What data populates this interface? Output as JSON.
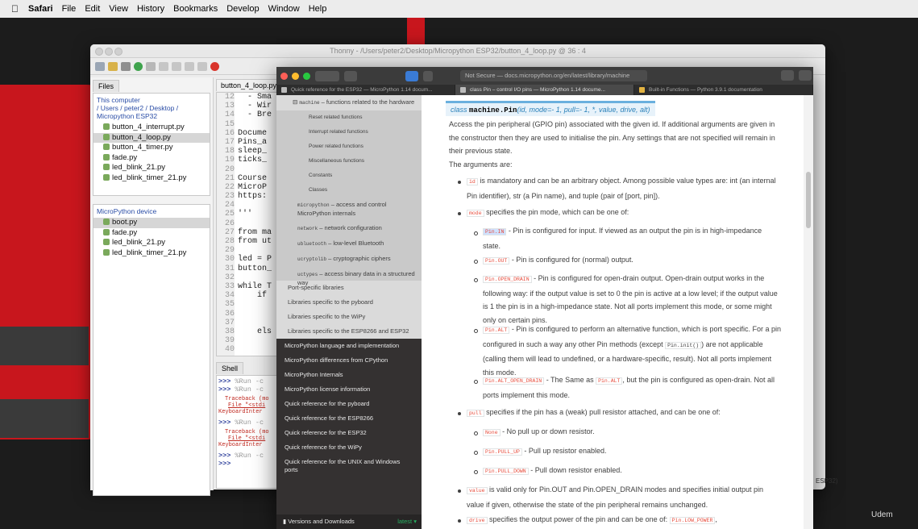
{
  "menubar": {
    "app": "Safari",
    "items": [
      "File",
      "Edit",
      "View",
      "History",
      "Bookmarks",
      "Develop",
      "Window",
      "Help"
    ]
  },
  "thonny": {
    "title": "Thonny - /Users/peter2/Desktop/Micropython ESP32/button_4_loop.py @ 36 : 4",
    "files_tab": "Files",
    "computer_path": "This computer\n/ Users / peter2 / Desktop /\nMicropython ESP32",
    "computer_files": [
      "button_4_interrupt.py",
      "button_4_loop.py",
      "button_4_timer.py",
      "fade.py",
      "led_blink_21.py",
      "led_blink_timer_21.py"
    ],
    "device_header": "MicroPython device",
    "device_files": [
      "boot.py",
      "fade.py",
      "led_blink_21.py",
      "led_blink_timer_21.py"
    ],
    "editor_tab": "button_4_loop.py",
    "line_numbers": [
      "12",
      "13",
      "14",
      "15",
      "16",
      "17",
      "18",
      "19",
      "20",
      "21",
      "22",
      "23",
      "24",
      "25",
      "26",
      "27",
      "28",
      "29",
      "30",
      "31",
      "32",
      "33",
      "34",
      "35",
      "36",
      "37",
      "38",
      "39",
      "40"
    ],
    "code_lines": [
      "  - Sma",
      "  - Wir",
      "  - Bre",
      "",
      "Docume",
      "Pins_a",
      "sleep_",
      "ticks_",
      "",
      "Course",
      "MicroP",
      "https:",
      "",
      "'''",
      "",
      "from ma",
      "from ut",
      "",
      "led = P",
      "button_",
      "",
      "while T",
      "    if",
      "",
      "",
      "",
      "    els",
      "",
      ""
    ],
    "shell_tab": "Shell",
    "shell": {
      "prompt": ">>>",
      "run": "%Run -c",
      "traceback": "Traceback (mo",
      "file_line": "File \"<stdi",
      "keyboard": "KeyboardInter"
    },
    "status_right": "ESP32)"
  },
  "browser": {
    "address": "Not Secure — docs.micropython.org/en/latest/library/machine",
    "tabs": [
      "Quick reference for the ESP32 — MicroPython 1.14 docum...",
      "class Pin – control I/O pins — MicroPython 1.14 docume...",
      "Built-in Functions — Python 3.9.1 documentation"
    ],
    "sidebar": {
      "machine_item": "machine – functions related to the hardware",
      "machine_code": "machine",
      "machine_sub": [
        "Reset related functions",
        "Interrupt related functions",
        "Power related functions",
        "Miscellaneous functions",
        "Constants",
        "Classes"
      ],
      "modules": [
        {
          "code": "micropython",
          "text": " – access and control MicroPython internals"
        },
        {
          "code": "network",
          "text": " – network configuration"
        },
        {
          "code": "ubluetooth",
          "text": " – low-level Bluetooth"
        },
        {
          "code": "ucryptolib",
          "text": " – cryptographic ciphers"
        },
        {
          "code": "uctypes",
          "text": " – access binary data in a structured way"
        }
      ],
      "port_items": [
        "Port-specific libraries",
        "Libraries specific to the pyboard",
        "Libraries specific to the WiPy",
        "Libraries specific to the ESP8266 and ESP32"
      ],
      "top_items": [
        "MicroPython language and implementation",
        "MicroPython differences from CPython",
        "MicroPython Internals",
        "MicroPython license information",
        "Quick reference for the pyboard",
        "Quick reference for the ESP8266",
        "Quick reference for the ESP32",
        "Quick reference for the WiPy",
        "Quick reference for the UNIX and Windows ports"
      ],
      "versions": "Versions and Downloads",
      "latest": "latest ▾"
    },
    "content": {
      "sig_class": "class",
      "sig_name": "machine.Pin",
      "sig_args": "(id, mode=- 1, pull=- 1, *, value, drive, alt)",
      "p1": "Access the pin peripheral (GPIO pin) associated with the given id. If additional arguments are given in the constructor then they are used to initialise the pin. Any settings that are not specified will remain in their previous state.",
      "p2": "The arguments are:",
      "id_chip": "id",
      "id_text": " is mandatory and can be an arbitrary object. Among possible value types are: int (an internal Pin identifier), str (a Pin name), and tuple (pair of [port, pin]).",
      "mode_chip": "mode",
      "mode_text": " specifies the pin mode, which can be one of:",
      "in_chip": "Pin.IN",
      "in_text": " - Pin is configured for input. If viewed as an output the pin is in high-impedance state.",
      "out_chip": "Pin.OUT",
      "out_text": " - Pin is configured for (normal) output.",
      "od_chip": "Pin.OPEN_DRAIN",
      "od_text": " - Pin is configured for open-drain output. Open-drain output works in the following way: if the output value is set to 0 the pin is active at a low level; if the output value is 1 the pin is in a high-impedance state. Not all ports implement this mode, or some might only on certain pins.",
      "alt_chip": "Pin.ALT",
      "alt_text1": " - Pin is configured to perform an alternative function, which is port specific. For a pin configured in such a way any other Pin methods (except ",
      "alt_init": "Pin.init()",
      "alt_text2": ") are not applicable (calling them will lead to undefined, or a hardware-specific, result). Not all ports implement this mode.",
      "altod_chip": "Pin.ALT_OPEN_DRAIN",
      "altod_text1": " - The Same as ",
      "altod_chip2": "Pin.ALT",
      "altod_text2": ", but the pin is configured as open-drain. Not all ports implement this mode.",
      "pull_chip": "pull",
      "pull_text": " specifies if the pin has a (weak) pull resistor attached, and can be one of:",
      "none_chip": "None",
      "none_text": " - No pull up or down resistor.",
      "pu_chip": "Pin.PULL_UP",
      "pu_text": " - Pull up resistor enabled.",
      "pd_chip": "Pin.PULL_DOWN",
      "pd_text": " - Pull down resistor enabled.",
      "value_chip": "value",
      "value_text": " is valid only for Pin.OUT and Pin.OPEN_DRAIN modes and specifies initial output pin value if given, otherwise the state of the pin peripheral remains unchanged.",
      "drive_chip": "drive",
      "drive_text": " specifies the output power of the pin and can be one of: ",
      "drive_chip2": "Pin.LOW_POWER",
      "drive_tail": ","
    }
  },
  "watermark": "Udem"
}
